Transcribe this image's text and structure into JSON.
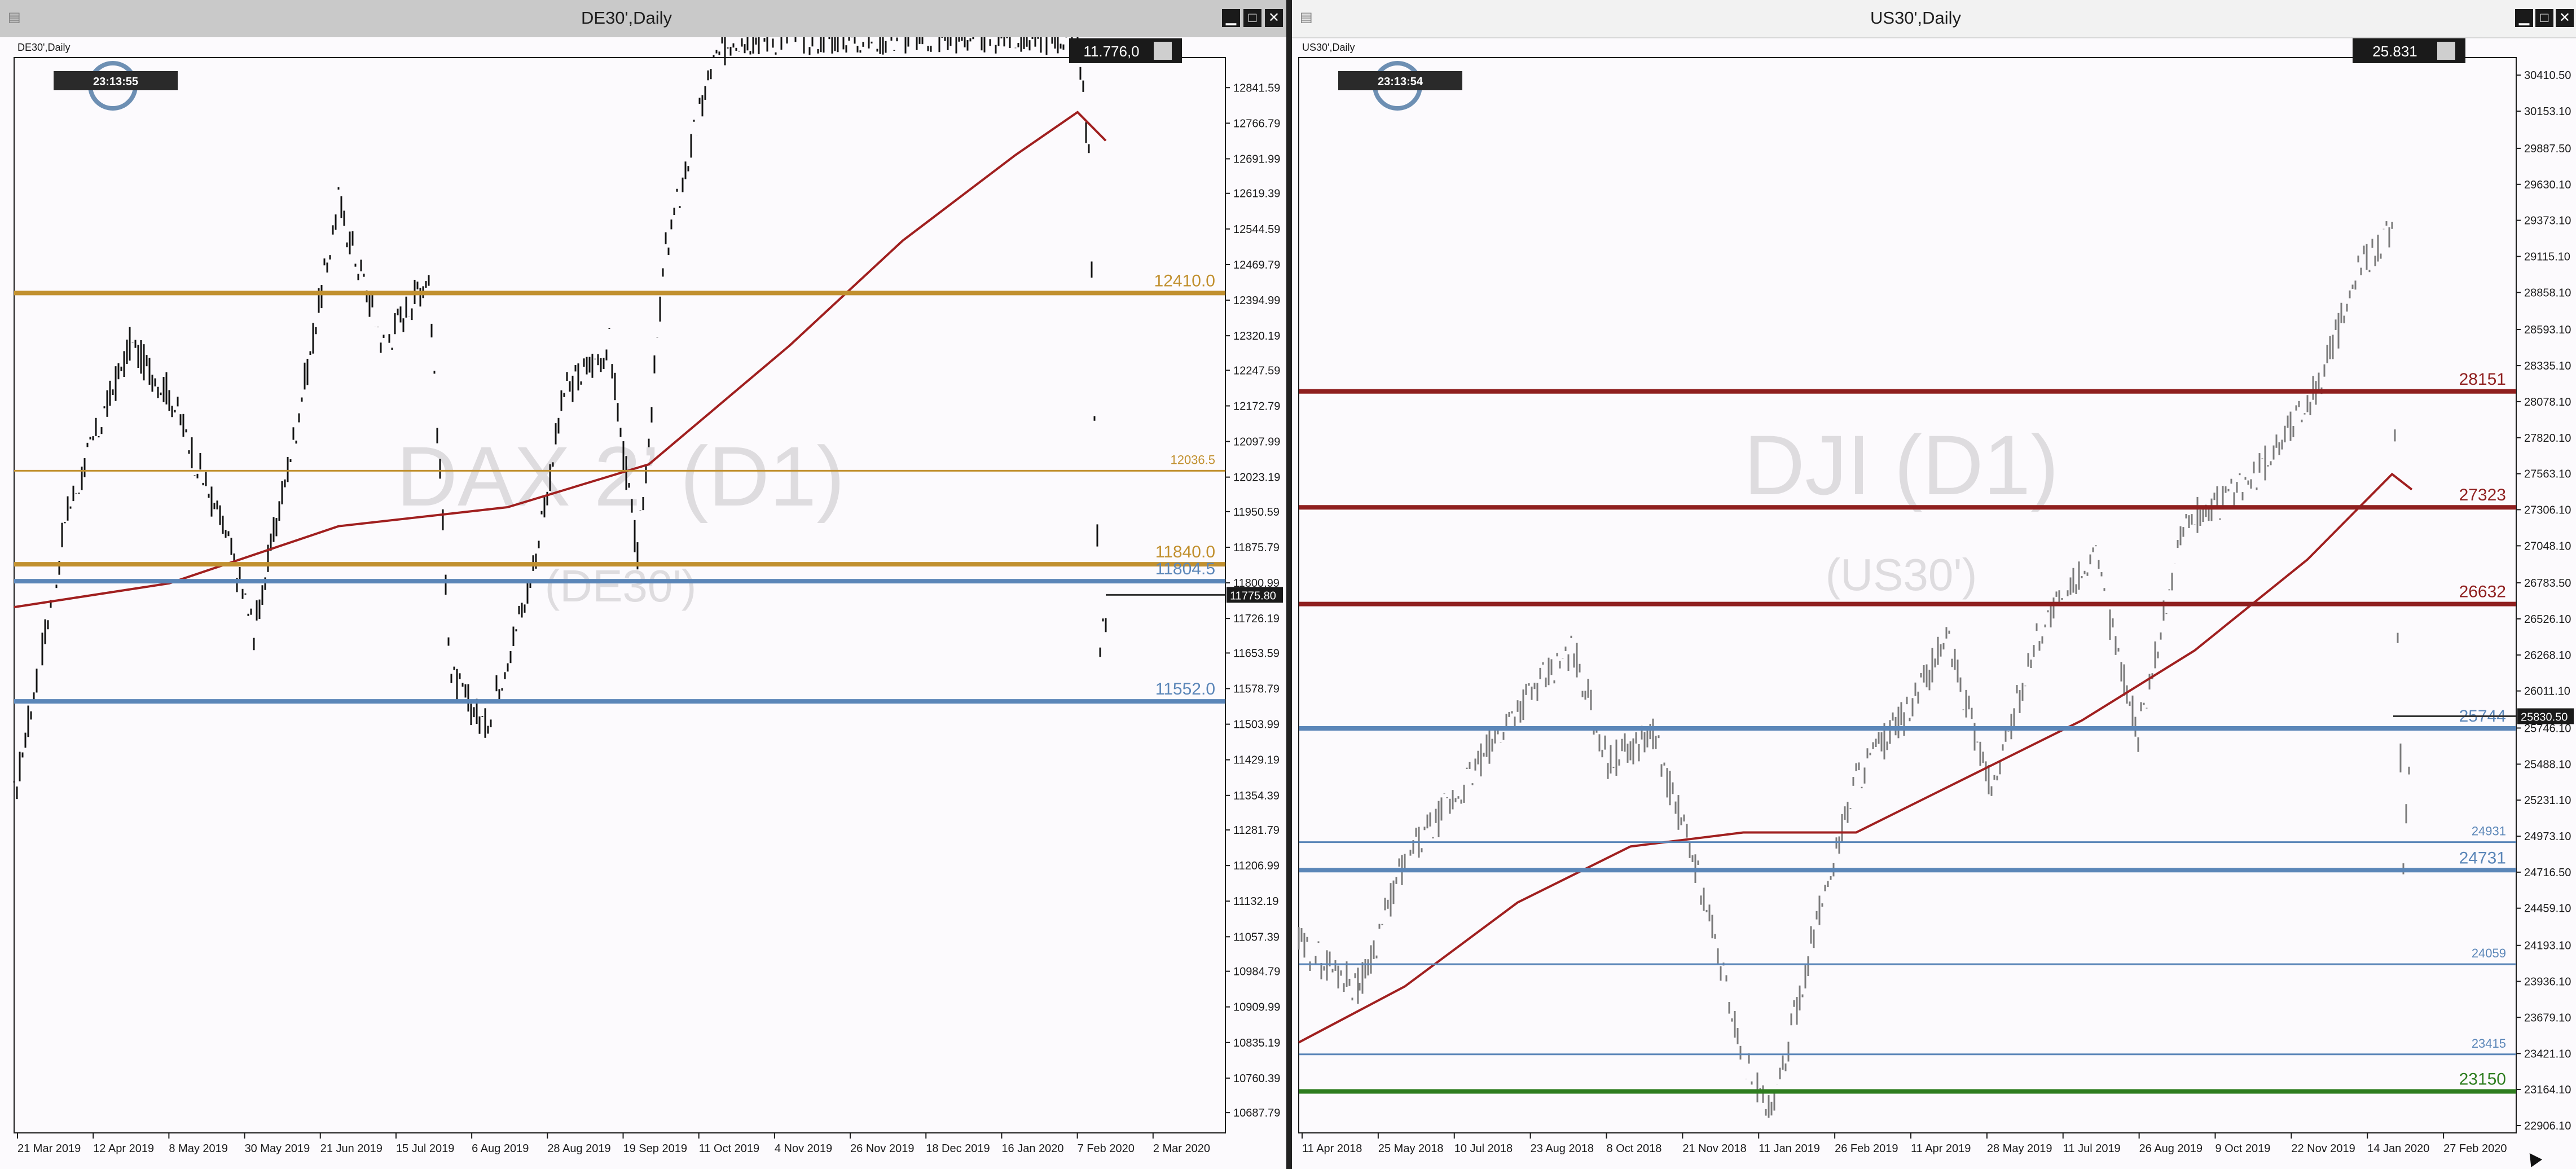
{
  "left": {
    "window_title": "DE30',Daily",
    "chart_label": "DE30',Daily",
    "clock": "23:13:55",
    "price_box": "11.776,0",
    "watermark_main": "DAX 2’ (D1)",
    "watermark_sub": "(DE30')",
    "y_ticks": [
      "12841.59",
      "12766.79",
      "12691.99",
      "12619.39",
      "12544.59",
      "12469.79",
      "12394.99",
      "12320.19",
      "12247.59",
      "12172.79",
      "12097.99",
      "12023.19",
      "11950.59",
      "11875.79",
      "11800.99",
      "11726.19",
      "11653.59",
      "11578.79",
      "11503.99",
      "11429.19",
      "11354.39",
      "11281.79",
      "11206.99",
      "11132.19",
      "11057.39",
      "10984.79",
      "10909.99",
      "10835.19",
      "10760.39",
      "10687.79"
    ],
    "x_labels": [
      "21 Mar 2019",
      "12 Apr 2019",
      "8 May 2019",
      "30 May 2019",
      "21 Jun 2019",
      "15 Jul 2019",
      "6 Aug 2019",
      "28 Aug 2019",
      "19 Sep 2019",
      "11 Oct 2019",
      "4 Nov 2019",
      "26 Nov 2019",
      "18 Dec 2019",
      "16 Jan 2020",
      "7 Feb 2020",
      "2 Mar 2020"
    ],
    "levels": [
      {
        "label": "12410.0",
        "value": 12410.0,
        "color": "#c1902f",
        "bold": true
      },
      {
        "label": "12036.5",
        "value": 12036.5,
        "color": "#c1902f",
        "bold": false
      },
      {
        "label": "11840.0",
        "value": 11840.0,
        "color": "#c1902f",
        "bold": true
      },
      {
        "label": "11804.5",
        "value": 11804.5,
        "color": "#5b86b8",
        "bold": true
      },
      {
        "label": "11552.0",
        "value": 11552.0,
        "color": "#5b86b8",
        "bold": true
      }
    ],
    "current_price": "11775.80",
    "range": [
      10650,
      12900
    ]
  },
  "right": {
    "window_title": "US30',Daily",
    "chart_label": "US30',Daily",
    "clock": "23:13:54",
    "price_box": "25.831",
    "watermark_main": "DJI (D1)",
    "watermark_sub": "(US30')",
    "y_ticks": [
      "30410.50",
      "30153.10",
      "29887.50",
      "29630.10",
      "29373.10",
      "29115.10",
      "28858.10",
      "28593.10",
      "28335.10",
      "28078.10",
      "27820.10",
      "27563.10",
      "27306.10",
      "27048.10",
      "26783.50",
      "26526.10",
      "26268.10",
      "26011.10",
      "25746.10",
      "25488.10",
      "25231.10",
      "24973.10",
      "24716.50",
      "24459.10",
      "24193.10",
      "23936.10",
      "23679.10",
      "23421.10",
      "23164.10",
      "22906.10"
    ],
    "x_labels": [
      "11 Apr 2018",
      "25 May 2018",
      "10 Jul 2018",
      "23 Aug 2018",
      "8 Oct 2018",
      "21 Nov 2018",
      "11 Jan 2019",
      "26 Feb 2019",
      "11 Apr 2019",
      "28 May 2019",
      "11 Jul 2019",
      "26 Aug 2019",
      "9 Oct 2019",
      "22 Nov 2019",
      "14 Jan 2020",
      "27 Feb 2020"
    ],
    "levels": [
      {
        "label": "28151",
        "value": 28151,
        "color": "#8f1f1f",
        "bold": true
      },
      {
        "label": "27323",
        "value": 27323,
        "color": "#8f1f1f",
        "bold": true
      },
      {
        "label": "26632",
        "value": 26632,
        "color": "#8f1f1f",
        "bold": true
      },
      {
        "label": "25744",
        "value": 25744,
        "color": "#5b86b8",
        "bold": true
      },
      {
        "label": "24931",
        "value": 24931,
        "color": "#5b86b8",
        "bold": false
      },
      {
        "label": "24731",
        "value": 24731,
        "color": "#5b86b8",
        "bold": true
      },
      {
        "label": "24059",
        "value": 24059,
        "color": "#5b86b8",
        "bold": false
      },
      {
        "label": "23415",
        "value": 23415,
        "color": "#5b86b8",
        "bold": false
      },
      {
        "label": "23150",
        "value": 23150,
        "color": "#2e7d1f",
        "bold": true
      }
    ],
    "current_price": "25830.50",
    "range": [
      22870,
      30520
    ]
  },
  "titlebar_buttons": {
    "minimize": "▁",
    "maximize": "□",
    "close": "✕"
  }
}
